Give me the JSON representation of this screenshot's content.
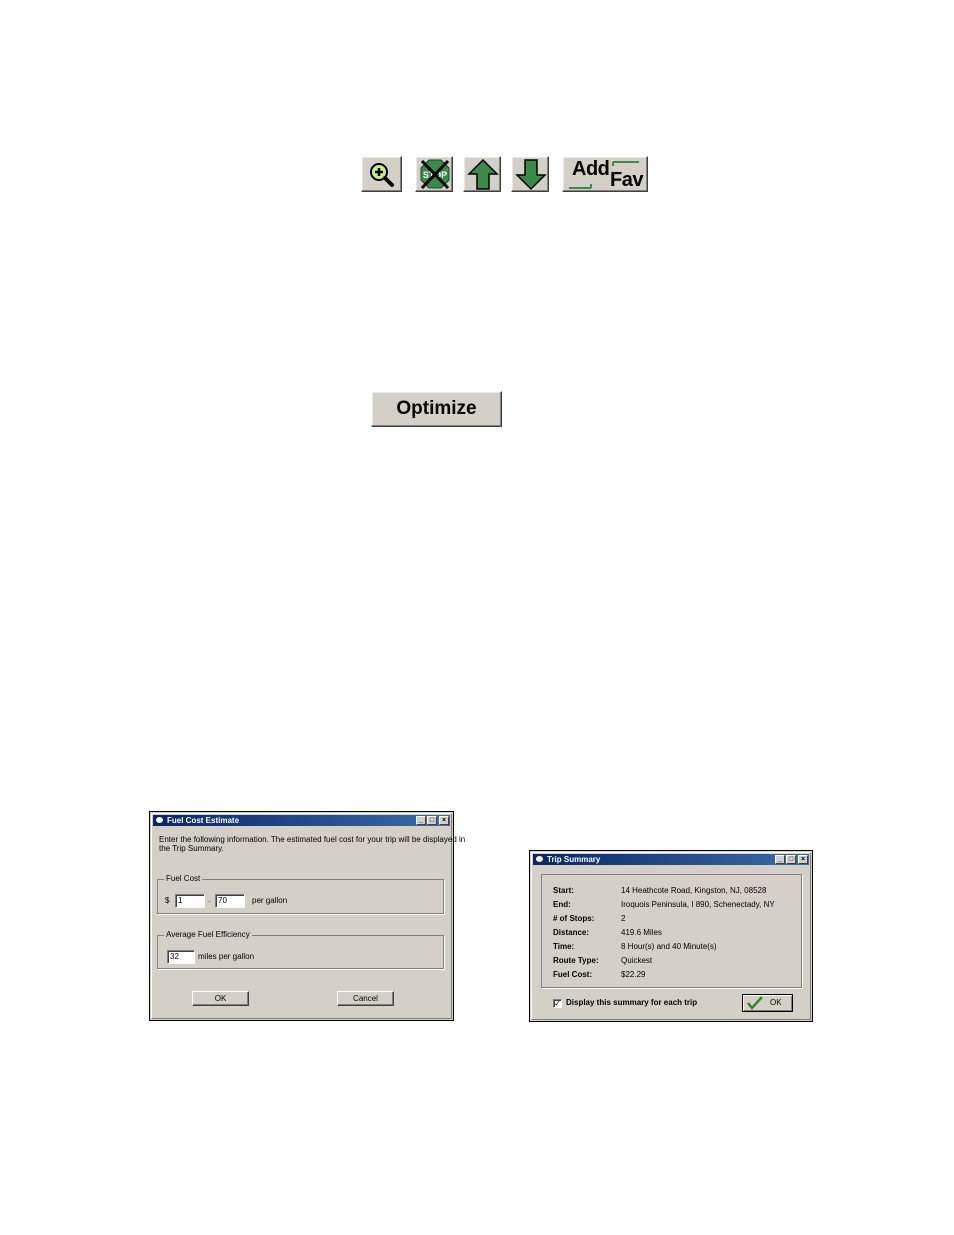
{
  "toolbar": {
    "zoom_icon": "magnifier-plus-icon",
    "stop_icon": "stop-sign-crossed-icon",
    "stop_label": "STOP",
    "up_icon": "arrow-up-icon",
    "down_icon": "arrow-down-icon",
    "addfav_add": "Add",
    "addfav_fav": "Fav"
  },
  "optimize_label": "Optimize",
  "fuel_dialog": {
    "title": "Fuel Cost Estimate",
    "intro_line1": "Enter the following information.  The estimated fuel cost for your trip will be displayed in",
    "intro_line2": "the Trip Summary.",
    "fuel_cost_group": "Fuel Cost",
    "currency": "$",
    "dollars": "1",
    "separator": ".",
    "cents": "70",
    "per_gallon": "per gallon",
    "efficiency_group": "Average Fuel Efficiency",
    "mpg": "32",
    "mpg_label": "miles per gallon",
    "ok": "OK",
    "cancel": "Cancel"
  },
  "trip_summary": {
    "title": "Trip Summary",
    "rows": [
      {
        "label": "Start:",
        "value": "14 Heathcote Road, Kingston, NJ, 08528"
      },
      {
        "label": "End:",
        "value": "Iroquois Peninsula, I 890, Schenectady, NY"
      },
      {
        "label": "# of Stops:",
        "value": "2"
      },
      {
        "label": "Distance:",
        "value": "419.6 Miles"
      },
      {
        "label": "Time:",
        "value": "8 Hour(s) and 40 Minute(s)"
      },
      {
        "label": "Route Type:",
        "value": "Quickest"
      },
      {
        "label": "Fuel Cost:",
        "value": "$22.29"
      }
    ],
    "checkbox_label": "Display this summary for each trip",
    "checkbox_checked": "✓",
    "ok": "OK"
  },
  "colors": {
    "button_face": "#d4d0c8",
    "arrow_green": "#3a8a4a",
    "title_blue": "#0a246a"
  }
}
